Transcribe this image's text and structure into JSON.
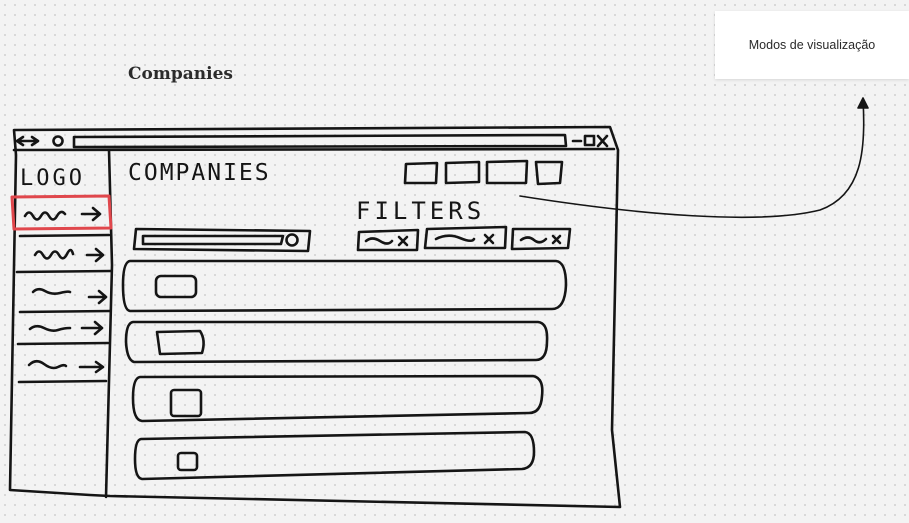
{
  "frame": {
    "title": "Companies"
  },
  "sticky_note": {
    "text": "Modos de visualização"
  },
  "wireframe": {
    "logo": "LOGO",
    "page_heading": "COMPANIES",
    "filters_label": "FILTERS",
    "nav_items": [
      {
        "label": "~~ →",
        "highlighted": true
      },
      {
        "label": "~~ →",
        "highlighted": false
      },
      {
        "label": "~~ →",
        "highlighted": false
      },
      {
        "label": "~~ →",
        "highlighted": false
      },
      {
        "label": "~~ →",
        "highlighted": false
      }
    ],
    "filter_chips": [
      "~x",
      "~x",
      "~x"
    ],
    "list_rows": 4,
    "view_mode_buttons": 4,
    "highlight_color": "#e0474c",
    "ink_color": "#151515"
  }
}
